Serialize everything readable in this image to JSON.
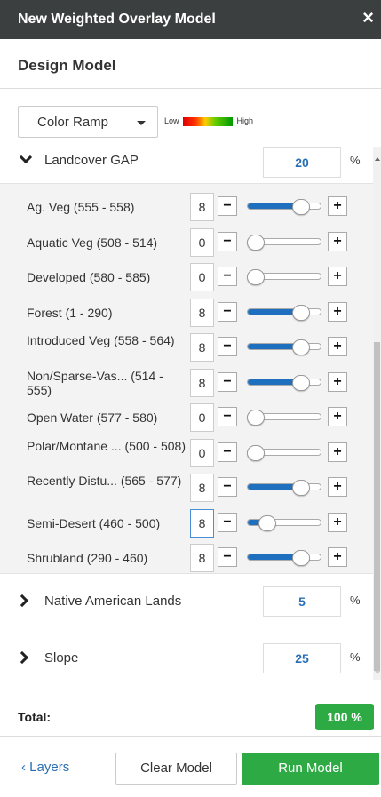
{
  "window": {
    "title": "New Weighted Overlay Model",
    "close_icon": "×"
  },
  "design": {
    "heading": "Design Model"
  },
  "ramp": {
    "button_label": "Color Ramp",
    "legend_low": "Low",
    "legend_high": "High"
  },
  "groups": [
    {
      "name": "Landcover GAP",
      "value": "20",
      "unit": "%",
      "expanded": true,
      "items": [
        {
          "name": "Ag. Veg (555 - 558)",
          "value": "8",
          "level": 0.8
        },
        {
          "name": "Aquatic Veg (508 - 514)",
          "value": "0",
          "level": 0.0
        },
        {
          "name": "Developed (580 - 585)",
          "value": "0",
          "level": 0.0
        },
        {
          "name": "Forest (1 - 290)",
          "value": "8",
          "level": 0.8
        },
        {
          "name": "Introduced Veg (558 - 564)",
          "value": "8",
          "level": 0.8
        },
        {
          "name": "Non/Sparse-Vas... (514 - 555)",
          "value": "8",
          "level": 0.8
        },
        {
          "name": "Open Water (577 - 580)",
          "value": "0",
          "level": 0.0
        },
        {
          "name": "Polar/Montane ... (500 - 508)",
          "value": "0",
          "level": 0.0
        },
        {
          "name": "Recently Distu... (565 - 577)",
          "value": "8",
          "level": 0.8
        },
        {
          "name": "Semi-Desert (460 - 500)",
          "value": "8",
          "level": 0.2
        },
        {
          "name": "Shrubland (290 - 460)",
          "value": "8",
          "level": 0.8
        }
      ]
    },
    {
      "name": "Native American Lands",
      "value": "5",
      "unit": "%",
      "expanded": false
    },
    {
      "name": "Slope",
      "value": "25",
      "unit": "%",
      "expanded": false
    }
  ],
  "total": {
    "label": "Total:",
    "value": "100 %"
  },
  "footer": {
    "layers_label": "Layers",
    "clear_label": "Clear Model",
    "run_label": "Run Model"
  },
  "colors": {
    "titlebar": "#3c3f3f",
    "accent_blue": "#1f6fbf",
    "green": "#2eaa45"
  }
}
